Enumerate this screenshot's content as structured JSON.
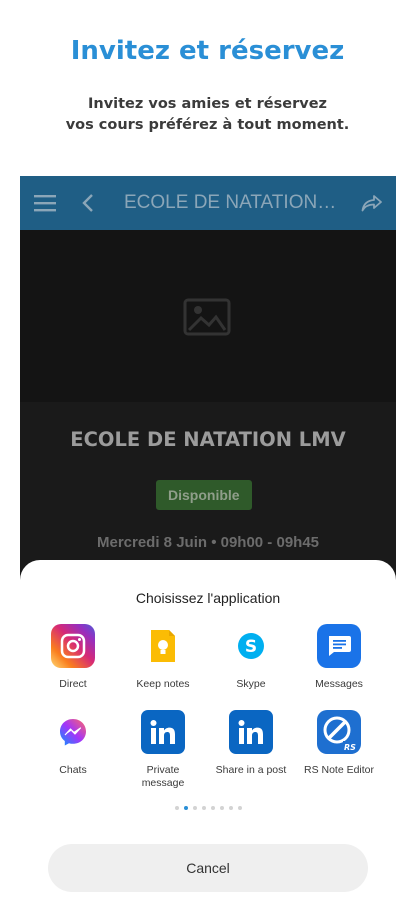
{
  "promo": {
    "title": "Invitez et réservez",
    "subtitle_line1": "Invitez vos amies et réservez",
    "subtitle_line2": "vos cours préférez à tout moment."
  },
  "appbar": {
    "title": "ECOLE DE NATATION LMV",
    "icons": [
      "menu-icon",
      "back-icon",
      "share-icon"
    ]
  },
  "event": {
    "title": "ECOLE DE NATATION LMV",
    "status": "Disponible",
    "date": "Mercredi 8 Juin  •  09h00 - 09h45",
    "image_icon": "image-placeholder-icon"
  },
  "share_sheet": {
    "title": "Choisissez l'application",
    "apps": [
      {
        "label": "Direct",
        "icon": "instagram-icon"
      },
      {
        "label": "Keep notes",
        "icon": "keep-notes-icon"
      },
      {
        "label": "Skype",
        "icon": "skype-icon"
      },
      {
        "label": "Messages",
        "icon": "messages-icon"
      },
      {
        "label": "Chats",
        "icon": "messenger-icon"
      },
      {
        "label": "Private message",
        "icon": "linkedin-icon"
      },
      {
        "label": "Share in a post",
        "icon": "linkedin-icon"
      },
      {
        "label": "RS Note Editor",
        "icon": "rs-note-editor-icon"
      }
    ],
    "page_count": 8,
    "active_page": 1,
    "cancel_label": "Cancel"
  },
  "colors": {
    "accent": "#2a8fd6",
    "appbar": "#1f5e85",
    "status_badge": "#2f5a2a",
    "linkedin": "#0a66c2"
  }
}
